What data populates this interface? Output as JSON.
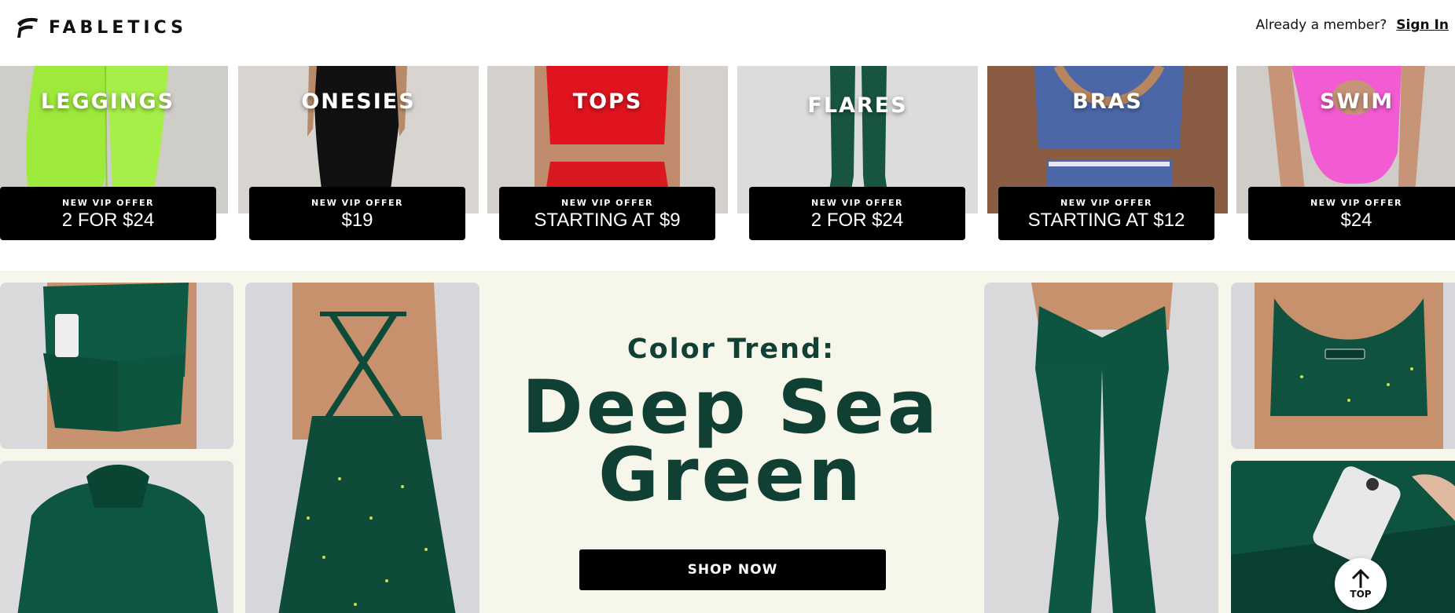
{
  "header": {
    "logo_text": "FABLETICS",
    "member_prompt": "Already a member?",
    "sign_in_label": "Sign In"
  },
  "categories": [
    {
      "label": "LEGGINGS",
      "offer_kicker": "NEW VIP OFFER",
      "offer": "2 FOR $24"
    },
    {
      "label": "ONESIES",
      "offer_kicker": "NEW VIP OFFER",
      "offer": "$19"
    },
    {
      "label": "TOPS",
      "offer_kicker": "NEW VIP OFFER",
      "offer": "STARTING AT $9"
    },
    {
      "label": "FLARES",
      "offer_kicker": "NEW VIP OFFER",
      "offer": "2 FOR $24"
    },
    {
      "label": "BRAS",
      "offer_kicker": "NEW VIP OFFER",
      "offer": "STARTING AT $12"
    },
    {
      "label": "SWIM",
      "offer_kicker": "NEW VIP OFFER",
      "offer": "$24"
    }
  ],
  "feature": {
    "kicker": "Color Trend:",
    "headline_line1": "Deep Sea",
    "headline_line2": "Green",
    "cta_label": "SHOP NOW"
  },
  "back_to_top_label": "TOP",
  "colors": {
    "brand_green": "#103f33",
    "feature_bg": "#f7f6ea",
    "offer_bg": "#000000"
  },
  "icons": {
    "logo": "fabletics-f-icon",
    "back_to_top": "arrow-up-icon"
  }
}
